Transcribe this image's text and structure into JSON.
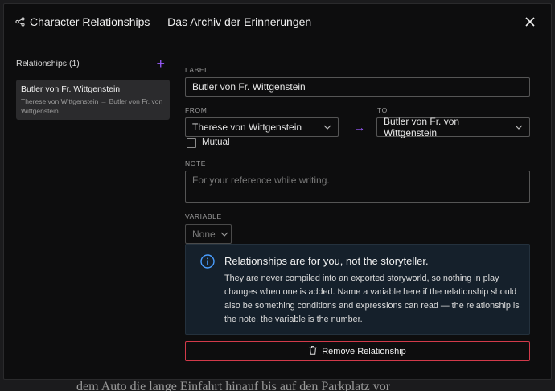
{
  "background": {
    "text": "dem Auto die lange Einfahrt hinauf bis auf den Parkplatz vor"
  },
  "modal": {
    "title": "Character Relationships — Das Archiv der Erinnerungen",
    "title_icon": "share-nodes-icon",
    "close_icon": "close-icon"
  },
  "sidebar": {
    "heading": "Relationships (1)",
    "add_icon": "plus-icon",
    "items": [
      {
        "name": "Butler von Fr. Wittgenstein",
        "subtitle": "Therese von Wittgenstein → Butler von Fr. von Wittgenstein"
      }
    ]
  },
  "form": {
    "label_heading": "LABEL",
    "label_value": "Butler von Fr. Wittgenstein",
    "from_heading": "FROM",
    "from_value": "Therese von Wittgenstein",
    "to_heading": "TO",
    "to_value": "Butler von Fr. von Wittgenstein",
    "arrow": "→",
    "mutual_label": "Mutual",
    "mutual_checked": false,
    "note_heading": "NOTE",
    "note_placeholder": "For your reference while writing.",
    "variable_heading": "VARIABLE",
    "variable_value": "None"
  },
  "info": {
    "icon": "info-circle-icon",
    "heading": "Relationships are for you, not the storyteller.",
    "body": "They are never compiled into an exported storyworld, so nothing in play changes when one is added. Name a variable here if the relationship should also be something conditions and expressions can read — the relationship is the note, the variable is the number."
  },
  "remove_button": {
    "label": "Remove Relationship",
    "icon": "trash-icon"
  },
  "colors": {
    "accent": "#9b5cff",
    "danger": "#d23a4a",
    "info_bg": "#15202b",
    "info_icon": "#4a9eff"
  }
}
